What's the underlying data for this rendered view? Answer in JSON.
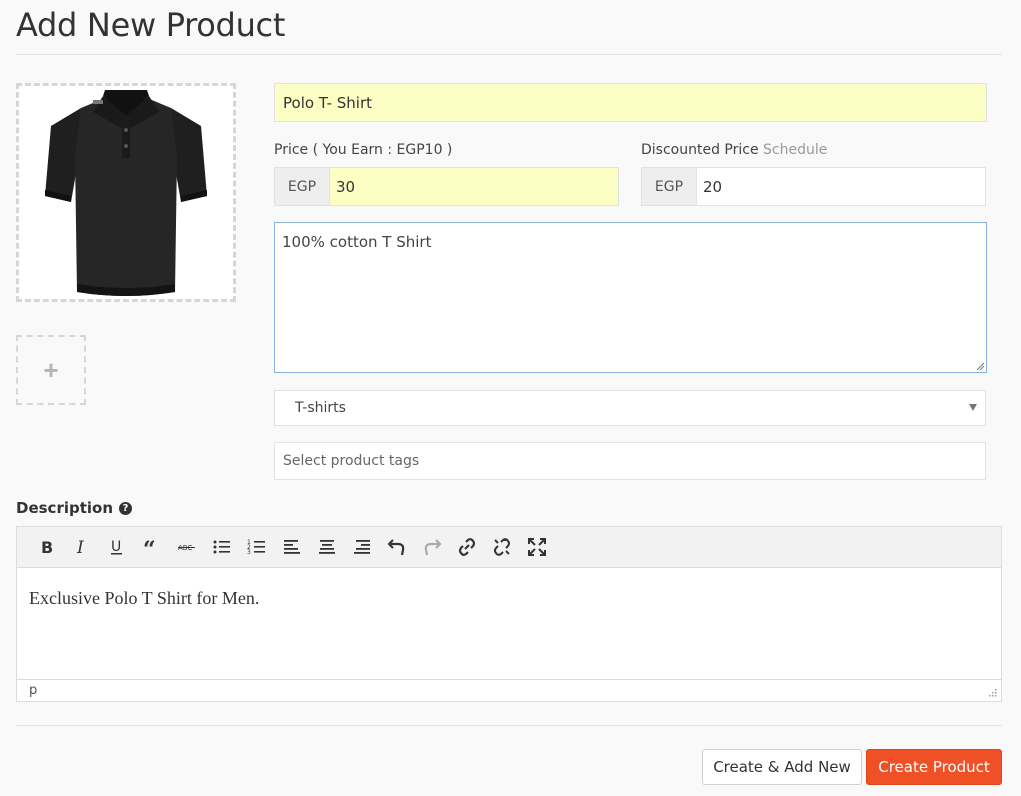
{
  "page": {
    "title": "Add New Product"
  },
  "product": {
    "name": "Polo T- Shirt",
    "price_label": "Price ( You Earn : EGP10 )",
    "price_currency": "EGP",
    "price_value": "30",
    "discount_label": "Discounted Price",
    "schedule_link": "Schedule",
    "discount_currency": "EGP",
    "discount_value": "20",
    "short_description": "100% cotton T Shirt",
    "category": "T-shirts",
    "tags_placeholder": "Select product tags"
  },
  "description": {
    "label": "Description",
    "content": "Exclusive Polo T Shirt for Men.",
    "path": "p",
    "toolbar": [
      "bold-icon",
      "italic-icon",
      "underline-icon",
      "blockquote-icon",
      "strikethrough-icon",
      "bullet-list-icon",
      "numbered-list-icon",
      "align-left-icon",
      "align-center-icon",
      "align-right-icon",
      "undo-icon",
      "redo-icon",
      "link-icon",
      "unlink-icon",
      "fullscreen-icon"
    ]
  },
  "actions": {
    "create_add_new": "Create & Add New",
    "create_product": "Create Product"
  },
  "colors": {
    "primary": "#f05025",
    "highlight": "#fcffc3",
    "focus": "#8ab0e4"
  }
}
